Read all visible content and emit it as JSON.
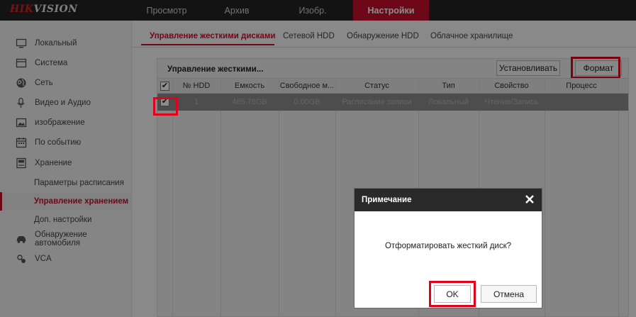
{
  "brand": {
    "part1": "HIK",
    "part2": "VISION"
  },
  "topnav": [
    {
      "label": "Просмотр"
    },
    {
      "label": "Архив"
    },
    {
      "label": "Изобр."
    },
    {
      "label": "Настройки",
      "active": true
    }
  ],
  "sidebar": {
    "items": [
      {
        "label": "Локальный",
        "icon": "monitor-icon"
      },
      {
        "label": "Система",
        "icon": "system-icon"
      },
      {
        "label": "Сеть",
        "icon": "globe-icon"
      },
      {
        "label": "Видео и Аудио",
        "icon": "mic-icon"
      },
      {
        "label": "изображение",
        "icon": "image-icon"
      },
      {
        "label": "По событию",
        "icon": "calendar-icon"
      },
      {
        "label": "Хранение",
        "icon": "storage-icon"
      }
    ],
    "subitems": [
      {
        "label": "Параметры расписания"
      },
      {
        "label": "Управление хранением",
        "active": true
      },
      {
        "label": "Доп. настройки"
      }
    ],
    "extra": [
      {
        "label": "Обнаружение автомобиля",
        "icon": "car-icon"
      },
      {
        "label": "VCA",
        "icon": "vca-icon"
      }
    ]
  },
  "tabs": [
    {
      "label": "Управление жесткими дисками",
      "active": true
    },
    {
      "label": "Сетевой HDD"
    },
    {
      "label": "Обнаружение HDD"
    },
    {
      "label": "Облачное хранилище"
    }
  ],
  "panel": {
    "title": "Управление жесткими...",
    "install_label": "Установливать",
    "format_label": "Формат"
  },
  "table": {
    "columns": [
      "№ HDD",
      "Емкость",
      "Свободное м...",
      "Статус",
      "Тип",
      "Свойство",
      "Процесс"
    ],
    "rows": [
      {
        "checked": true,
        "cells": [
          "1",
          "465.76GB",
          "0.00GB",
          "Расписание записи",
          "Локальный",
          "Чтение/Запись",
          ""
        ]
      }
    ]
  },
  "dialog": {
    "title": "Примечание",
    "message": "Отформатировать жесткий диск?",
    "ok_label": "OK",
    "cancel_label": "Отмена"
  },
  "colors": {
    "accent": "#c8102e",
    "highlight": "#e3001b",
    "topbar": "#232323"
  }
}
